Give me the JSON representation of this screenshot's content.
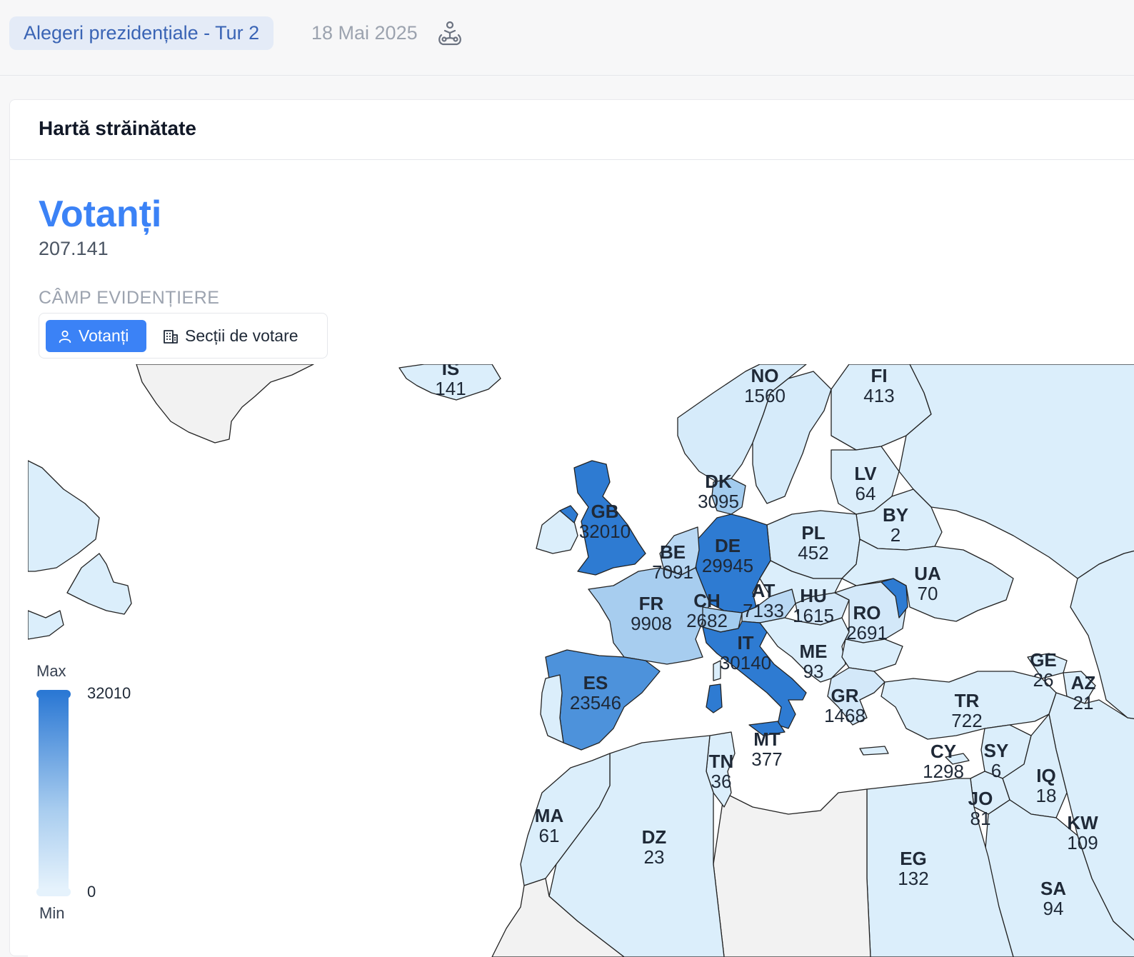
{
  "header": {
    "election": "Alegeri prezidențiale - Tur 2",
    "date": "18 Mai 2025",
    "icon": "people-group-icon"
  },
  "card": {
    "title": "Hartă străinătate",
    "metric_title": "Votanți",
    "metric_value": "207.141",
    "field_label": "CÂMP EVIDENȚIERE",
    "toggle": {
      "votanti": "Votanți",
      "sectii": "Secții de votare",
      "active": "votanti"
    }
  },
  "legend": {
    "max_label": "Max",
    "min_label": "Min",
    "max_value": "32010",
    "min_value": "0"
  },
  "colors": {
    "accent": "#3b82f6",
    "scale_max": "#2b78d4",
    "scale_min": "#e5f2fc",
    "no_data": "#f2f2f2"
  },
  "countries": [
    {
      "code": "IS",
      "value": "141"
    },
    {
      "code": "NO",
      "value": "1560"
    },
    {
      "code": "FI",
      "value": "413"
    },
    {
      "code": "DK",
      "value": "3095"
    },
    {
      "code": "LV",
      "value": "64"
    },
    {
      "code": "BY",
      "value": "2"
    },
    {
      "code": "GB",
      "value": "32010"
    },
    {
      "code": "PL",
      "value": "452"
    },
    {
      "code": "DE",
      "value": "29945"
    },
    {
      "code": "BE",
      "value": "7091"
    },
    {
      "code": "UA",
      "value": "70"
    },
    {
      "code": "FR",
      "value": "9908"
    },
    {
      "code": "AT",
      "value": "7133"
    },
    {
      "code": "HU",
      "value": "1615"
    },
    {
      "code": "CH",
      "value": "2682"
    },
    {
      "code": "RO",
      "value": "2691"
    },
    {
      "code": "IT",
      "value": "30140"
    },
    {
      "code": "ME",
      "value": "93"
    },
    {
      "code": "GE",
      "value": "26"
    },
    {
      "code": "ES",
      "value": "23546"
    },
    {
      "code": "AZ",
      "value": "21"
    },
    {
      "code": "GR",
      "value": "1468"
    },
    {
      "code": "TR",
      "value": "722"
    },
    {
      "code": "MT",
      "value": "377"
    },
    {
      "code": "CY",
      "value": "1298"
    },
    {
      "code": "SY",
      "value": "6"
    },
    {
      "code": "TN",
      "value": "36"
    },
    {
      "code": "IQ",
      "value": "18"
    },
    {
      "code": "JO",
      "value": "81"
    },
    {
      "code": "MA",
      "value": "61"
    },
    {
      "code": "KW",
      "value": "109"
    },
    {
      "code": "DZ",
      "value": "23"
    },
    {
      "code": "EG",
      "value": "132"
    },
    {
      "code": "SA",
      "value": "94"
    }
  ]
}
